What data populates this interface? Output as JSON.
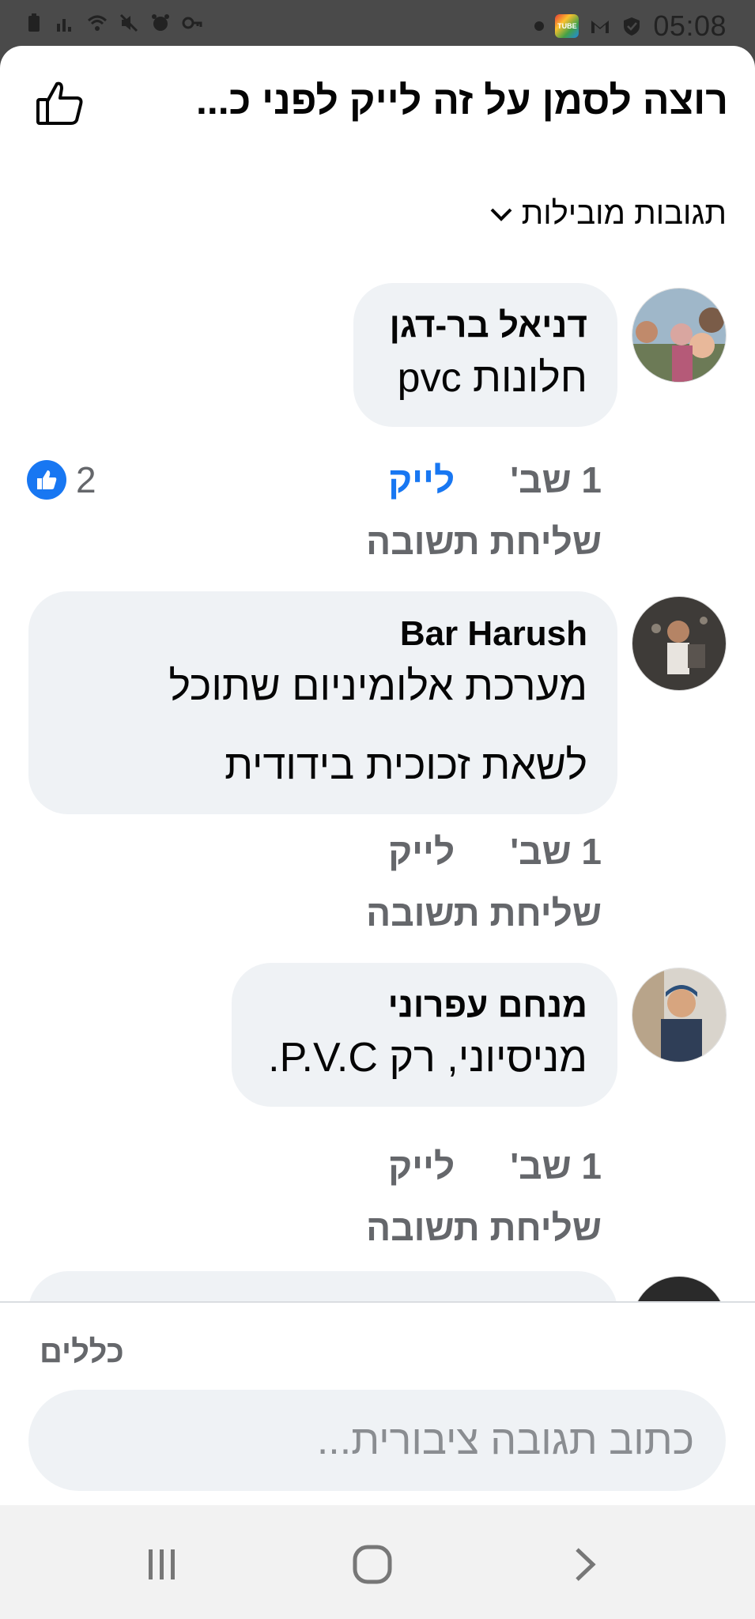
{
  "status_bar": {
    "time": "05:08",
    "icons": [
      "battery-icon",
      "signal-icon",
      "wifi-icon",
      "mute-icon",
      "alarm-icon",
      "vpn-key-icon",
      "notification-dot-icon",
      "tube-app-icon",
      "gmail-icon",
      "shield-icon"
    ]
  },
  "header": {
    "title": "רוצה לסמן על זה לייק לפני כ...",
    "like_icon": "thumbs-up-outline-icon"
  },
  "sort": {
    "label": "תגובות מובילות",
    "icon": "chevron-down-icon"
  },
  "comments": [
    {
      "author": "דניאל בר-דגן",
      "text_lines": [
        "חלונות pvc"
      ],
      "time": "1 שב'",
      "like_label": "לייק",
      "liked": true,
      "reply_label": "שליחת תשובה",
      "reaction_count": "2"
    },
    {
      "author": "Bar Harush",
      "text_lines": [
        "מערכת אלומיניום שתוכל",
        "לשאת זכוכית בידודית"
      ],
      "time": "1 שב'",
      "like_label": "לייק",
      "liked": false,
      "reply_label": "שליחת תשובה"
    },
    {
      "author": "מנחם עפרוני",
      "text_lines": [
        "מניסיוני, רק P.V.C."
      ],
      "time": "1 שב'",
      "like_label": "לייק",
      "liked": false,
      "reply_label": "שליחת תשובה"
    }
  ],
  "footer": {
    "rules_label": "כללים",
    "composer_placeholder": "כתוב תגובה ציבורית..."
  },
  "colors": {
    "accent": "#1877f2",
    "bubble": "#eff2f5",
    "secondary_text": "#65676b"
  }
}
